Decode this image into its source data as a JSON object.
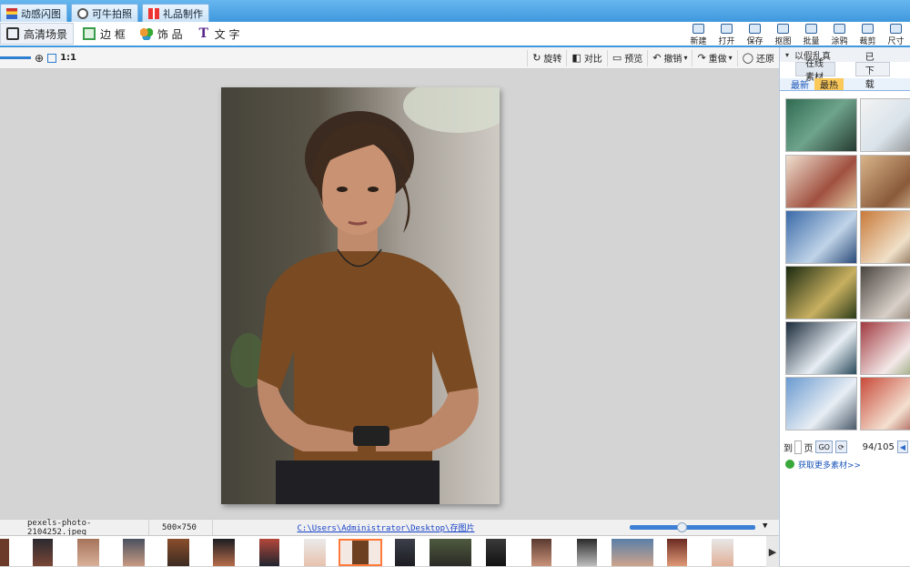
{
  "tabs": [
    {
      "label": "动感闪图"
    },
    {
      "label": "可牛拍照"
    },
    {
      "label": "礼品制作"
    }
  ],
  "toolbar": {
    "items": [
      {
        "label": "高清场景"
      },
      {
        "label": "边 框"
      },
      {
        "label": "饰 品"
      },
      {
        "label": "文 字"
      }
    ],
    "right": [
      {
        "label": "新建"
      },
      {
        "label": "打开"
      },
      {
        "label": "保存"
      },
      {
        "label": "抠图"
      },
      {
        "label": "批量"
      },
      {
        "label": "涂鸦"
      },
      {
        "label": "裁剪"
      },
      {
        "label": "尺寸"
      }
    ]
  },
  "subbar": {
    "zoom_label": "1:1",
    "actions": [
      "旋转",
      "对比",
      "预览",
      "撤销",
      "重做",
      "还原"
    ]
  },
  "status": {
    "filename": "pexels-photo-2104252.jpeg",
    "dimensions": "500×750",
    "path": "C:\\Users\\Administrator\\Desktop\\存图片"
  },
  "side": {
    "title": "以假乱真",
    "tabs": [
      "在线素材",
      "已下载"
    ],
    "subtabs": [
      "最新",
      "最热"
    ],
    "pager": {
      "goto_label": "到",
      "page_unit": "页",
      "go_label": "GO",
      "count": "94/105"
    },
    "more_link": "获取更多素材>>"
  },
  "colors": {
    "accent": "#3f98dd",
    "selected_thumb": "#ff7a3a",
    "subtab_active": "#fbc85a"
  }
}
